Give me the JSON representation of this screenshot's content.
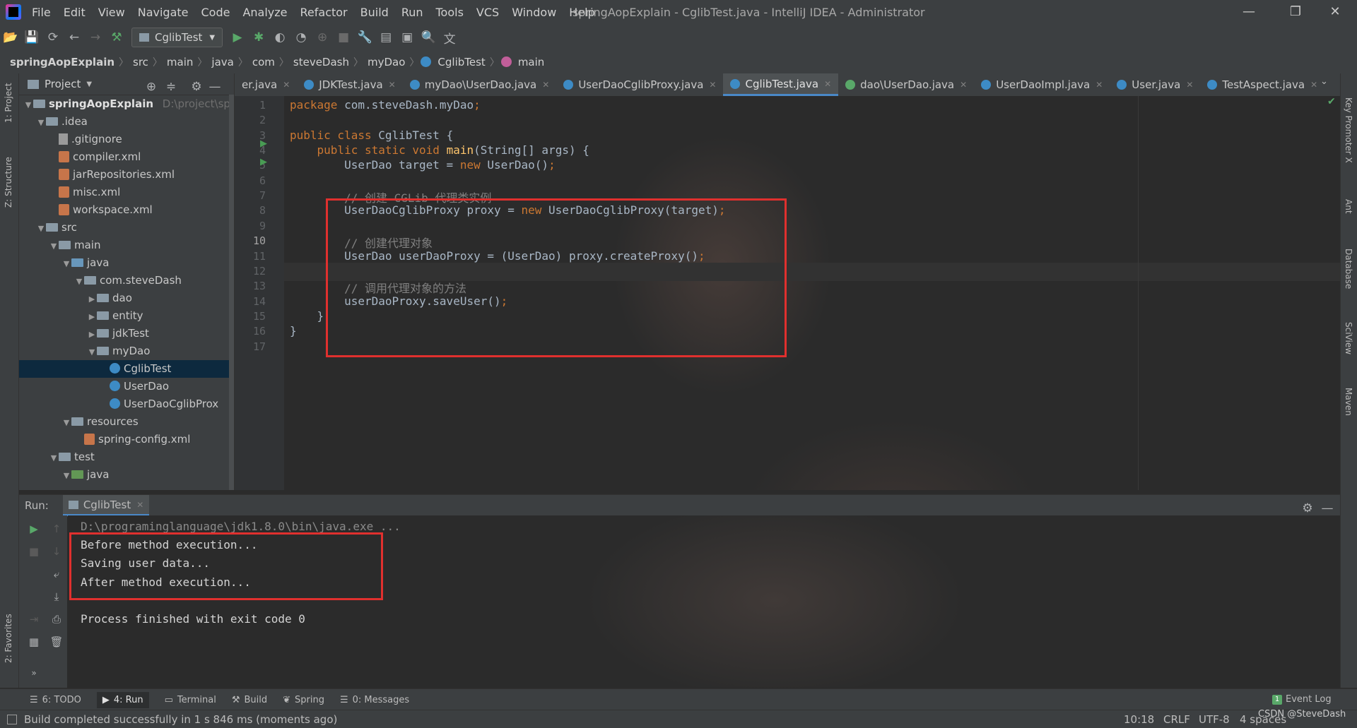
{
  "app": {
    "title": "springAopExplain - CglibTest.java - IntelliJ IDEA - Administrator",
    "menu": [
      "File",
      "Edit",
      "View",
      "Navigate",
      "Code",
      "Analyze",
      "Refactor",
      "Build",
      "Run",
      "Tools",
      "VCS",
      "Window",
      "Help"
    ]
  },
  "toolbar": {
    "run_config": "CglibTest"
  },
  "breadcrumb": [
    "springAopExplain",
    "src",
    "main",
    "java",
    "com",
    "steveDash",
    "myDao",
    "CglibTest",
    "main"
  ],
  "left_stripe": {
    "project": "1: Project",
    "structure": "Z: Structure",
    "favorites": "2: Favorites"
  },
  "right_stripe": [
    "Key Promoter X",
    "Ant",
    "Database",
    "SciView",
    "Maven"
  ],
  "project_panel": {
    "title": "Project",
    "root_name": "springAopExplain",
    "root_path": "D:\\project\\spring",
    "tree": [
      {
        "label": ".idea",
        "depth": 1,
        "icon": "folder",
        "arrow": "down"
      },
      {
        "label": ".gitignore",
        "depth": 2,
        "icon": "file"
      },
      {
        "label": "compiler.xml",
        "depth": 2,
        "icon": "xml"
      },
      {
        "label": "jarRepositories.xml",
        "depth": 2,
        "icon": "xml"
      },
      {
        "label": "misc.xml",
        "depth": 2,
        "icon": "xml"
      },
      {
        "label": "workspace.xml",
        "depth": 2,
        "icon": "xml"
      },
      {
        "label": "src",
        "depth": 1,
        "icon": "folder",
        "arrow": "down"
      },
      {
        "label": "main",
        "depth": 2,
        "icon": "folder",
        "arrow": "down"
      },
      {
        "label": "java",
        "depth": 3,
        "icon": "src-folder",
        "arrow": "down"
      },
      {
        "label": "com.steveDash",
        "depth": 4,
        "icon": "folder",
        "arrow": "down"
      },
      {
        "label": "dao",
        "depth": 5,
        "icon": "folder",
        "arrow": "right"
      },
      {
        "label": "entity",
        "depth": 5,
        "icon": "folder",
        "arrow": "right"
      },
      {
        "label": "jdkTest",
        "depth": 5,
        "icon": "folder",
        "arrow": "right"
      },
      {
        "label": "myDao",
        "depth": 5,
        "icon": "folder",
        "arrow": "down"
      },
      {
        "label": "CglibTest",
        "depth": 6,
        "icon": "class",
        "selected": true
      },
      {
        "label": "UserDao",
        "depth": 6,
        "icon": "class"
      },
      {
        "label": "UserDaoCglibProx",
        "depth": 6,
        "icon": "class"
      },
      {
        "label": "resources",
        "depth": 3,
        "icon": "res-folder",
        "arrow": "down"
      },
      {
        "label": "spring-config.xml",
        "depth": 4,
        "icon": "xml"
      },
      {
        "label": "test",
        "depth": 2,
        "icon": "folder",
        "arrow": "down"
      },
      {
        "label": "java",
        "depth": 3,
        "icon": "test-folder",
        "arrow": "down"
      }
    ]
  },
  "tabs": [
    {
      "label": "er.java",
      "icon": "none"
    },
    {
      "label": "JDKTest.java",
      "icon": "class"
    },
    {
      "label": "myDao\\UserDao.java",
      "icon": "class"
    },
    {
      "label": "UserDaoCglibProxy.java",
      "icon": "class"
    },
    {
      "label": "CglibTest.java",
      "icon": "class",
      "active": true
    },
    {
      "label": "dao\\UserDao.java",
      "icon": "interface"
    },
    {
      "label": "UserDaoImpl.java",
      "icon": "class"
    },
    {
      "label": "User.java",
      "icon": "class"
    },
    {
      "label": "TestAspect.java",
      "icon": "class"
    }
  ],
  "editor": {
    "current_line": 10,
    "lines": [
      {
        "n": 1,
        "html": "<span class='kw'>package </span>com.steveDash.myDao<span class='kw'>;</span>"
      },
      {
        "n": 2,
        "html": ""
      },
      {
        "n": 3,
        "html": "<span class='kw'>public class </span>CglibTest {"
      },
      {
        "n": 4,
        "html": "    <span class='kw'>public static void </span><span class='fn'>main</span>(String[] args) {"
      },
      {
        "n": 5,
        "html": "        UserDao target = <span class='kw'>new </span>UserDao()<span class='kw'>;</span>"
      },
      {
        "n": 6,
        "html": ""
      },
      {
        "n": 7,
        "html": "        <span class='cm'>// 创建 CGLib 代理类实例</span>"
      },
      {
        "n": 8,
        "html": "        UserDaoCglibProxy proxy = <span class='kw'>new </span>UserDaoCglibProxy(target)<span class='kw'>;</span>"
      },
      {
        "n": 9,
        "html": ""
      },
      {
        "n": 10,
        "html": "        <span class='cm'>// 创建代理对象</span>"
      },
      {
        "n": 11,
        "html": "        UserDao userDaoProxy = (UserDao) proxy.createProxy()<span class='kw'>;</span>"
      },
      {
        "n": 12,
        "html": ""
      },
      {
        "n": 13,
        "html": "        <span class='cm'>// 调用代理对象的方法</span>"
      },
      {
        "n": 14,
        "html": "        userDaoProxy.saveUser()<span class='kw'>;</span>"
      },
      {
        "n": 15,
        "html": "    }"
      },
      {
        "n": 16,
        "html": "}"
      },
      {
        "n": 17,
        "html": ""
      }
    ]
  },
  "run_panel": {
    "label": "Run:",
    "tab": "CglibTest",
    "console": [
      {
        "text": "D:\\programinglanguage\\jdk1.8.0\\bin\\java.exe ...",
        "color": "#8a8a8a"
      },
      {
        "text": "Before method execution...",
        "color": "#d4d4d4"
      },
      {
        "text": "Saving user data...",
        "color": "#d4d4d4"
      },
      {
        "text": "After method execution...",
        "color": "#d4d4d4"
      },
      {
        "text": "",
        "color": "#d4d4d4"
      },
      {
        "text": "Process finished with exit code 0",
        "color": "#d4d4d4"
      }
    ]
  },
  "tool_windows": [
    {
      "label": "6: TODO",
      "icon": "☰"
    },
    {
      "label": "4: Run",
      "icon": "▶",
      "active": true
    },
    {
      "label": "Terminal",
      "icon": "▭"
    },
    {
      "label": "Build",
      "icon": "⚒"
    },
    {
      "label": "Spring",
      "icon": "❦"
    },
    {
      "label": "0: Messages",
      "icon": "☰"
    }
  ],
  "event_log": "Event Log",
  "status": {
    "message": "Build completed successfully in 1 s 846 ms (moments ago)",
    "position": "10:18",
    "line_sep": "CRLF",
    "encoding": "UTF-8",
    "indent": "4 spaces",
    "watermark": "CSDN @SteveDash"
  },
  "colors": {
    "accent": "#4a88c7",
    "highlight_box": "#e0302e",
    "keyword": "#cc7832",
    "comment": "#808080"
  }
}
